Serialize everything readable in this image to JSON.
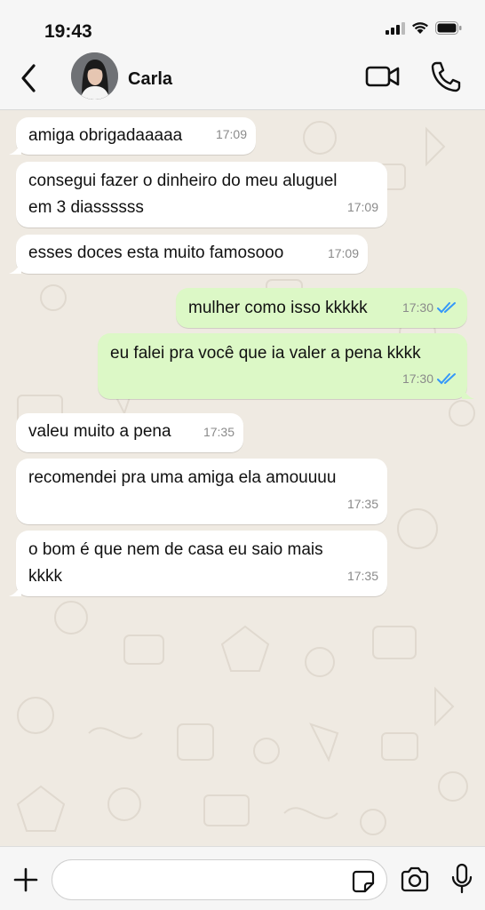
{
  "status": {
    "time": "19:43"
  },
  "header": {
    "contact_name": "Carla"
  },
  "messages": [
    {
      "dir": "in",
      "text": "amiga obrigadaaaaa",
      "time": "17:09"
    },
    {
      "dir": "in",
      "text": "consegui fazer o dinheiro do meu aluguel em 3 diassssss",
      "time": "17:09"
    },
    {
      "dir": "in",
      "text": "esses doces esta muito famosooo",
      "time": "17:09"
    },
    {
      "dir": "out",
      "text": "mulher como isso kkkkk",
      "time": "17:30",
      "read": true
    },
    {
      "dir": "out",
      "text": "eu falei pra você que ia valer a pena kkkk",
      "time": "17:30",
      "read": true
    },
    {
      "dir": "in",
      "text": "valeu muito a pena",
      "time": "17:35"
    },
    {
      "dir": "in",
      "text": "recomendei pra uma amiga ela amouuuu",
      "time": "17:35"
    },
    {
      "dir": "in",
      "text": "o bom é que nem de casa eu saio mais kkkk",
      "time": "17:35"
    }
  ],
  "composer": {
    "value": "",
    "placeholder": ""
  },
  "colors": {
    "incoming": "#ffffff",
    "outgoing": "#dcf8c6",
    "read_ticks": "#3497f9",
    "chat_bg": "#efeae2"
  },
  "icons": [
    "back-icon",
    "video-call-icon",
    "phone-icon",
    "plus-icon",
    "sticker-icon",
    "camera-icon",
    "mic-icon",
    "double-check-icon"
  ]
}
